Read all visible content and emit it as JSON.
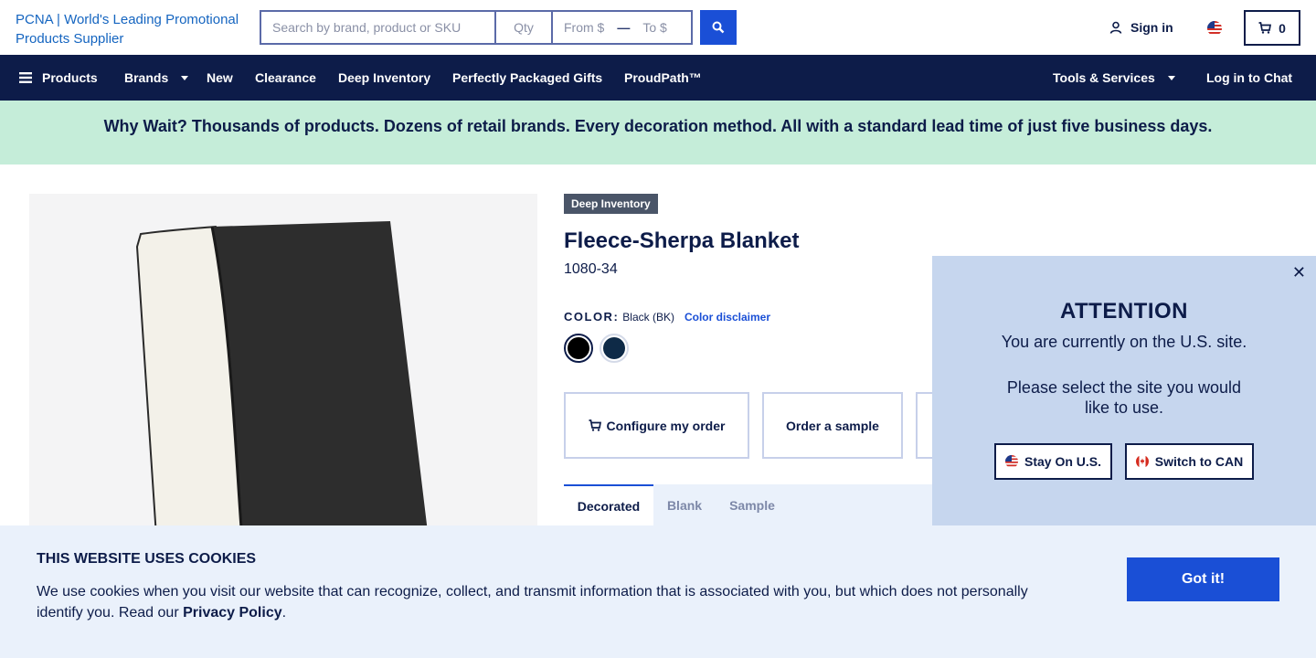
{
  "header": {
    "logo_alt": "PCNA | World's Leading Promotional Products Supplier",
    "search_placeholder": "Search by brand, product or SKU",
    "qty_placeholder": "Qty",
    "from_placeholder": "From $",
    "to_placeholder": "To $",
    "signin_label": "Sign in",
    "cart_count": "0",
    "accent_color": "#1a4fd6",
    "navy_color": "#0d1c49"
  },
  "nav": {
    "products": "Products",
    "brands": "Brands",
    "new": "New",
    "clearance": "Clearance",
    "deep_inventory": "Deep Inventory",
    "gifts": "Perfectly Packaged Gifts",
    "proudpath": "ProudPath™",
    "tools": "Tools & Services",
    "chat": "Log in to Chat"
  },
  "promo": {
    "text": "Why Wait? Thousands of products. Dozens of retail brands. Every decoration method. All with a standard lead time of just five business days.",
    "bg_color": "#c5edd9"
  },
  "product": {
    "badge": "Deep Inventory",
    "title": "Fleece-Sherpa Blanket",
    "sku": "1080-34",
    "color_label": "COLOR:",
    "color_value": "Black (BK)",
    "color_disclaimer": "Color disclaimer",
    "swatches": [
      {
        "name": "Black",
        "color": "#000000"
      },
      {
        "name": "Navy",
        "color": "#0e2a47"
      }
    ],
    "configure_label": "Configure my order",
    "sample_label": "Order a sample",
    "tabs": [
      "Decorated",
      "Blank",
      "Sample"
    ]
  },
  "attention": {
    "close": "✕",
    "heading": "ATTENTION",
    "line1": "You are currently on the U.S. site.",
    "line2": "Please select the site you would like to use.",
    "stay_label": "Stay On U.S.",
    "switch_label": "Switch to CAN"
  },
  "cookie": {
    "heading": "THIS WEBSITE USES COOKIES",
    "text": "We use cookies when you visit our website that can recognize, collect, and transmit information that is associated with you, but which does not personally identify you. Read our ",
    "link": "Privacy Policy",
    "period": ".",
    "button": "Got it!"
  }
}
